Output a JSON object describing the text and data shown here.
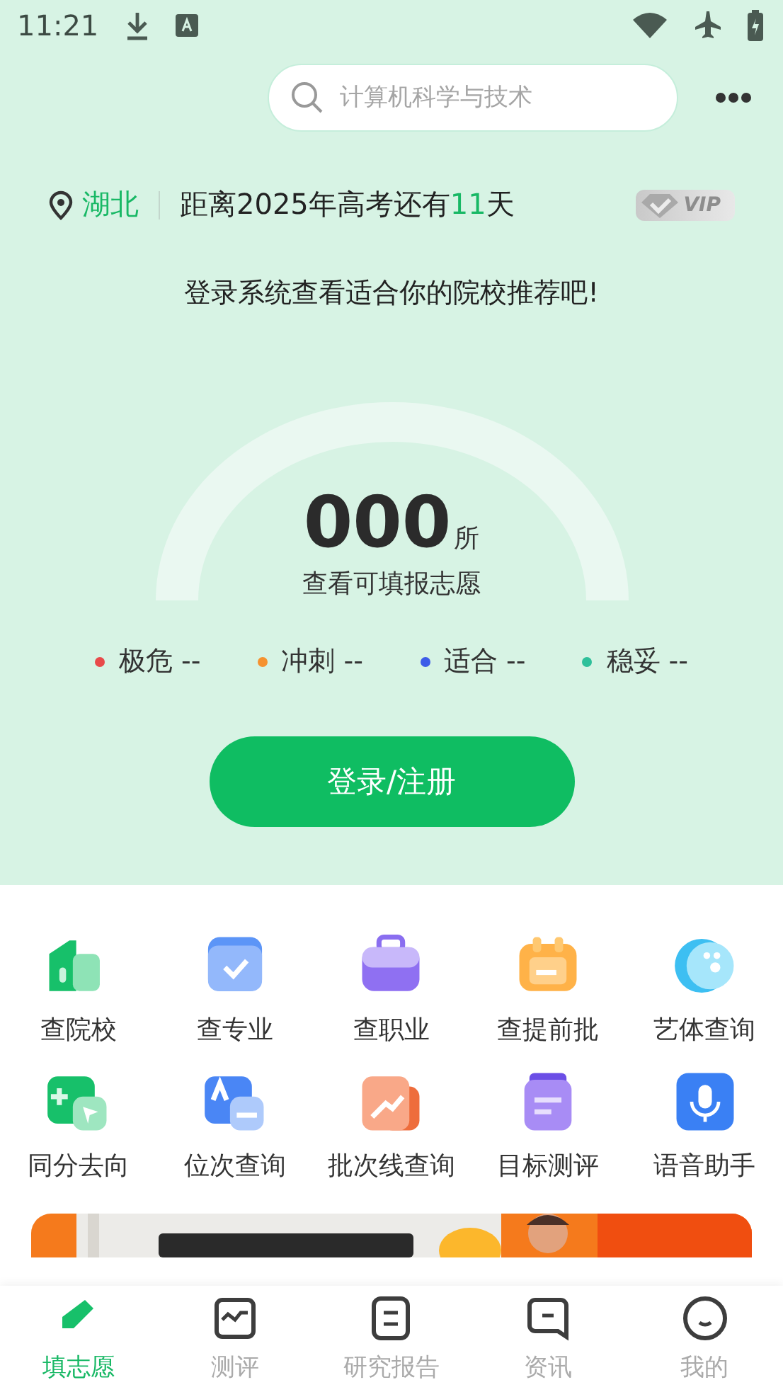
{
  "status_bar": {
    "time": "11:21"
  },
  "search": {
    "placeholder": "计算机科学与技术"
  },
  "header": {
    "province": "湖北",
    "countdown": "距离2025年高考还有**11**天",
    "vip": "VIP"
  },
  "prompt": "登录系统查看适合你的院校推荐吧!",
  "gauge": {
    "count": "000",
    "unit": "所",
    "caption": "查看可填报志愿"
  },
  "legend": [
    {
      "label": "极危 --",
      "color": "#e84a4a"
    },
    {
      "label": "冲刺 --",
      "color": "#f5922f"
    },
    {
      "label": "适合 --",
      "color": "#3d5ce8"
    },
    {
      "label": "稳妥 --",
      "color": "#2ec09a"
    }
  ],
  "login_button": "登录/注册",
  "features": [
    {
      "label": "查院校"
    },
    {
      "label": "查专业"
    },
    {
      "label": "查职业"
    },
    {
      "label": "查提前批"
    },
    {
      "label": "艺体查询"
    },
    {
      "label": "同分去向"
    },
    {
      "label": "位次查询"
    },
    {
      "label": "批次线查询"
    },
    {
      "label": "目标测评"
    },
    {
      "label": "语音助手"
    }
  ],
  "tabs": [
    {
      "label": "填志愿",
      "selected": true
    },
    {
      "label": "测评",
      "selected": false
    },
    {
      "label": "研究报告",
      "selected": false
    },
    {
      "label": "资讯",
      "selected": false
    },
    {
      "label": "我的",
      "selected": false
    }
  ]
}
